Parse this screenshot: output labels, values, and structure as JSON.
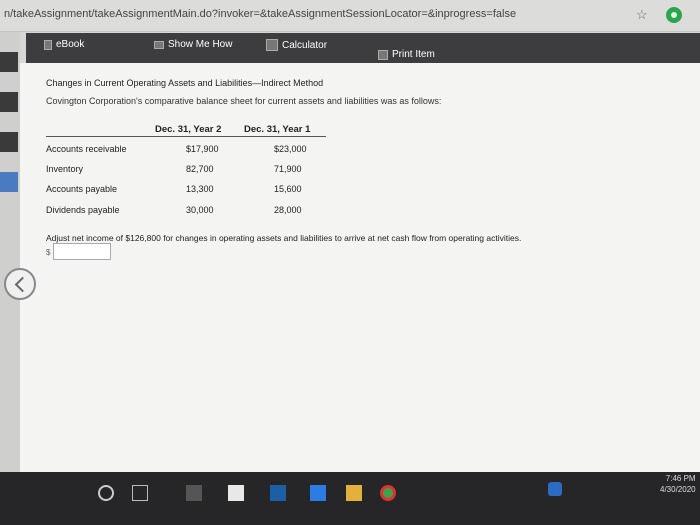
{
  "browser": {
    "url": "n/takeAssignment/takeAssignmentMain.do?invoker=&takeAssignmentSessionLocator=&inprogress=false"
  },
  "toolbar": {
    "ebook": "eBook",
    "show_me_how": "Show Me How",
    "calculator": "Calculator",
    "print_item": "Print Item"
  },
  "problem": {
    "title": "Changes in Current Operating Assets and Liabilities—Indirect Method",
    "intro": "Covington Corporation's comparative balance sheet for current assets and liabilities was as follows:",
    "columns": [
      "Dec. 31, Year 2",
      "Dec. 31, Year 1"
    ],
    "rows": [
      {
        "label": "Accounts receivable",
        "year2": "$17,900",
        "year1": "$23,000"
      },
      {
        "label": "Inventory",
        "year2": "82,700",
        "year1": "71,900"
      },
      {
        "label": "Accounts payable",
        "year2": "13,300",
        "year1": "15,600"
      },
      {
        "label": "Dividends payable",
        "year2": "30,000",
        "year1": "28,000"
      }
    ],
    "instruction": "Adjust net income of $126,800 for changes in operating assets and liabilities to arrive at net cash flow from operating activities.",
    "currency_prefix": "$",
    "answer_value": ""
  },
  "taskbar": {
    "time": "7:46 PM",
    "date": "4/30/2020"
  },
  "colors": {
    "toolbar_bg": "#3d3d3f",
    "taskbar_bg": "#262628"
  }
}
